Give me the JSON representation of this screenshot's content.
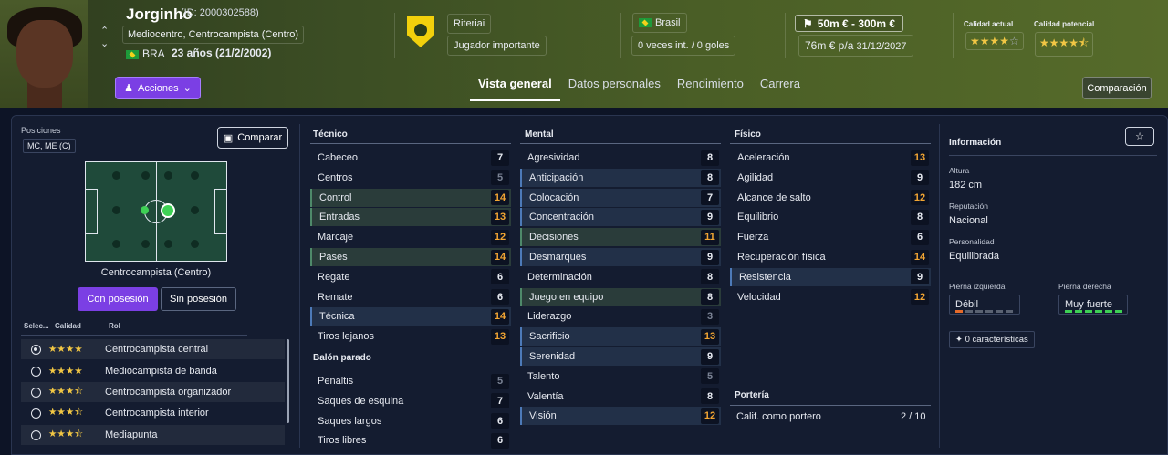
{
  "player": {
    "name": "Jorginho",
    "id": "(ID: 2000302588)",
    "position": "Mediocentro, Centrocampista (Centro)",
    "nationality_code": "BRA",
    "age": "23 años (21/2/2002)",
    "actions_label": "Acciones"
  },
  "club": {
    "name": "Riteriai",
    "role": "Jugador importante",
    "country": "Brasil",
    "caps": "0 veces int. / 0 goles"
  },
  "value": {
    "range": "50m € - 300m €",
    "wage": "76m € p/a",
    "contract": "31/12/2027"
  },
  "ability": {
    "current_label": "Calidad actual",
    "potential_label": "Calidad potencial",
    "current_stars": 4,
    "potential_stars": 4.5
  },
  "tabs": [
    "Vista general",
    "Datos personales",
    "Rendimiento",
    "Carrera"
  ],
  "compare_btn": "Comparación",
  "left": {
    "positions_label": "Posiciones",
    "positions_value": "MC, ME (C)",
    "compare_label": "Comparar",
    "pitch_role": "Centrocampista (Centro)",
    "with_ball": "Con posesión",
    "without_ball": "Sin posesión",
    "col_select": "Selec...",
    "col_quality": "Calidad",
    "col_role": "Rol",
    "roles": [
      {
        "name": "Centrocampista central",
        "stars": 4,
        "selected": true
      },
      {
        "name": "Mediocampista de banda",
        "stars": 4,
        "selected": false
      },
      {
        "name": "Centrocampista organizador",
        "stars": 3.5,
        "selected": false
      },
      {
        "name": "Centrocampista interior",
        "stars": 3.5,
        "selected": false
      },
      {
        "name": "Mediapunta",
        "stars": 3.5,
        "selected": false
      }
    ]
  },
  "technical": {
    "title": "Técnico",
    "items": [
      {
        "name": "Cabeceo",
        "value": "7"
      },
      {
        "name": "Centros",
        "value": "5"
      },
      {
        "name": "Control",
        "value": "14"
      },
      {
        "name": "Entradas",
        "value": "13"
      },
      {
        "name": "Marcaje",
        "value": "12"
      },
      {
        "name": "Pases",
        "value": "14"
      },
      {
        "name": "Regate",
        "value": "6"
      },
      {
        "name": "Remate",
        "value": "6"
      },
      {
        "name": "Técnica",
        "value": "14"
      },
      {
        "name": "Tiros lejanos",
        "value": "13"
      }
    ]
  },
  "set_pieces": {
    "title": "Balón parado",
    "items": [
      {
        "name": "Penaltis",
        "value": "5"
      },
      {
        "name": "Saques de esquina",
        "value": "7"
      },
      {
        "name": "Saques largos",
        "value": "6"
      },
      {
        "name": "Tiros libres",
        "value": "6"
      }
    ]
  },
  "mental": {
    "title": "Mental",
    "items": [
      {
        "name": "Agresividad",
        "value": "8"
      },
      {
        "name": "Anticipación",
        "value": "8"
      },
      {
        "name": "Colocación",
        "value": "7"
      },
      {
        "name": "Concentración",
        "value": "9"
      },
      {
        "name": "Decisiones",
        "value": "11"
      },
      {
        "name": "Desmarques",
        "value": "9"
      },
      {
        "name": "Determinación",
        "value": "8"
      },
      {
        "name": "Juego en equipo",
        "value": "8"
      },
      {
        "name": "Liderazgo",
        "value": "3"
      },
      {
        "name": "Sacrificio",
        "value": "13"
      },
      {
        "name": "Serenidad",
        "value": "9"
      },
      {
        "name": "Talento",
        "value": "5"
      },
      {
        "name": "Valentía",
        "value": "8"
      },
      {
        "name": "Visión",
        "value": "12"
      }
    ]
  },
  "physical": {
    "title": "Físico",
    "items": [
      {
        "name": "Aceleración",
        "value": "13"
      },
      {
        "name": "Agilidad",
        "value": "9"
      },
      {
        "name": "Alcance de salto",
        "value": "12"
      },
      {
        "name": "Equilibrio",
        "value": "8"
      },
      {
        "name": "Fuerza",
        "value": "6"
      },
      {
        "name": "Recuperación física",
        "value": "14"
      },
      {
        "name": "Resistencia",
        "value": "9"
      },
      {
        "name": "Velocidad",
        "value": "12"
      }
    ]
  },
  "goalkeeping": {
    "title": "Portería",
    "label": "Calif. como portero",
    "value": "2 / 10"
  },
  "info": {
    "title": "Información",
    "height_label": "Altura",
    "height": "182 cm",
    "reputation_label": "Reputación",
    "reputation": "Nacional",
    "personality_label": "Personalidad",
    "personality": "Equilibrada",
    "left_foot_label": "Pierna izquierda",
    "left_foot": "Débil",
    "right_foot_label": "Pierna derecha",
    "right_foot": "Muy fuerte",
    "traits": "0 características"
  }
}
